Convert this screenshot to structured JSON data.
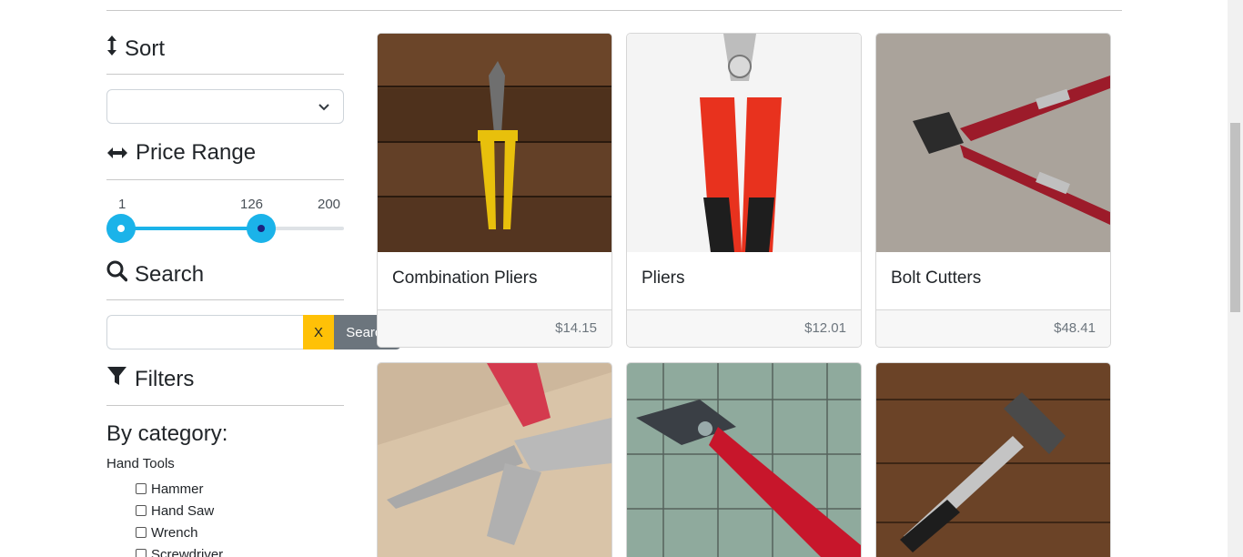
{
  "sidebar": {
    "sort": {
      "title": "Sort",
      "icon": "vertical-arrows-icon",
      "selected": ""
    },
    "price_range": {
      "title": "Price Range",
      "icon": "horizontal-arrows-icon",
      "min_label": "1",
      "value_label": "126",
      "max_label": "200",
      "min": 1,
      "max": 200,
      "low": 1,
      "high": 126
    },
    "search": {
      "title": "Search",
      "icon": "magnifier-icon",
      "input_value": "",
      "clear_label": "X",
      "button_label": "Search"
    },
    "filters": {
      "title": "Filters",
      "icon": "funnel-icon",
      "by_category_label": "By category:",
      "group_label": "Hand Tools",
      "items": [
        {
          "label": "Hammer",
          "checked": false
        },
        {
          "label": "Hand Saw",
          "checked": false
        },
        {
          "label": "Wrench",
          "checked": false
        },
        {
          "label": "Screwdriver",
          "checked": false
        }
      ]
    }
  },
  "products": [
    {
      "name": "Combination Pliers",
      "price": "$14.15"
    },
    {
      "name": "Pliers",
      "price": "$12.01"
    },
    {
      "name": "Bolt Cutters",
      "price": "$48.41"
    },
    {
      "name": "",
      "price": ""
    },
    {
      "name": "",
      "price": ""
    },
    {
      "name": "",
      "price": ""
    }
  ],
  "colors": {
    "accent": "#1bb3e9",
    "clear": "#ffc107",
    "search_btn": "#6c757d"
  }
}
